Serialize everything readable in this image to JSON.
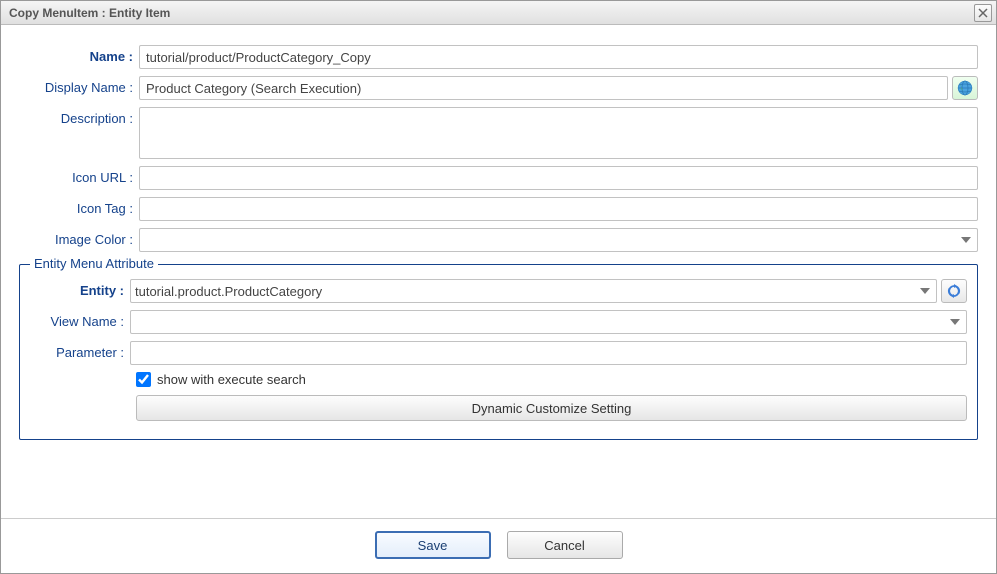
{
  "dialog": {
    "title": "Copy MenuItem : Entity Item"
  },
  "form": {
    "name": {
      "label": "Name :",
      "value": "tutorial/product/ProductCategory_Copy"
    },
    "displayName": {
      "label": "Display Name :",
      "value": "Product Category (Search Execution)"
    },
    "description": {
      "label": "Description :",
      "value": ""
    },
    "iconUrl": {
      "label": "Icon URL :",
      "value": ""
    },
    "iconTag": {
      "label": "Icon Tag :",
      "value": ""
    },
    "imageColor": {
      "label": "Image Color :",
      "value": ""
    }
  },
  "fieldset": {
    "legend": "Entity Menu Attribute",
    "entity": {
      "label": "Entity :",
      "value": "tutorial.product.ProductCategory"
    },
    "viewName": {
      "label": "View Name :",
      "value": ""
    },
    "parameter": {
      "label": "Parameter :",
      "value": ""
    },
    "showWithExecute": {
      "label": "show with execute search",
      "checked": true
    },
    "dynamicButton": "Dynamic Customize Setting"
  },
  "buttons": {
    "save": "Save",
    "cancel": "Cancel"
  }
}
